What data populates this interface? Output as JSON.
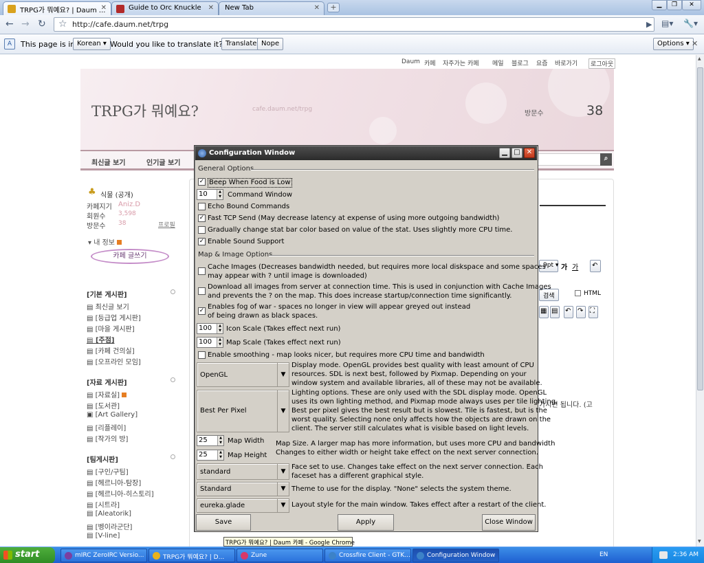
{
  "browser": {
    "tabs": [
      {
        "title": "TRPG가 뭐예요? | Daum ...",
        "active": true
      },
      {
        "title": "Guide to Orc Knuckle",
        "active": false
      },
      {
        "title": "New Tab",
        "active": false
      }
    ],
    "url": "http://cafe.daum.net/trpg",
    "translate_bar": {
      "prefix": "This page is in",
      "language": "Korean",
      "question": "Would you like to translate it?",
      "translate_label": "Translate",
      "nope_label": "Nope",
      "options_label": "Options"
    }
  },
  "page": {
    "gnb": [
      "Daum",
      "카페",
      "자주가는 카페",
      "메일",
      "블로그",
      "요즘",
      "바로가기",
      "로그아웃"
    ],
    "cafe_title": "TRPG가 뭐예요?",
    "cafe_url": "cafe.daum.net/trpg",
    "visitors_label": "방문수",
    "visitors_count": "38",
    "menu": [
      "최신글 보기",
      "인기글 보기"
    ],
    "side": {
      "rank": "식물 (공개)",
      "manager_label": "카페지기",
      "manager_value": "Aniz.D",
      "members_label": "회원수",
      "members_value": "3,598",
      "visit_label": "방문수",
      "visit_value": "38",
      "profile": "프로필",
      "my_info": "내 정보",
      "write_button": "카페 글쓰기",
      "sections": [
        {
          "title": "[기본 게시판]",
          "items": [
            "최신글 보기",
            "[등급업 게시판]",
            "[마을 게시판]",
            "[주점]",
            "[카페 건의실]",
            "[오프라인 모임]"
          ]
        },
        {
          "title": "[자료 게시판]",
          "items": [
            "[자료실]",
            "[도서관]",
            "[Art Gallery]",
            "[리플레이]",
            "[작가의 방]"
          ]
        },
        {
          "title": "[팀게시판]",
          "items": [
            "[구인/구팀]",
            "[헤르니아-탐장]",
            "[헤르니아-히스토리]",
            "[시트라]",
            "[Aleatorik]",
            "[벵이라군단]",
            "[V-line]"
          ]
        }
      ]
    },
    "editor": {
      "font_size": "9pt",
      "html_label": "HTML",
      "search_label": "검색",
      "fragment": "가시면 됩니다. (고"
    }
  },
  "config_window": {
    "title": "Configuration Window",
    "general_label": "General Options",
    "map_label": "Map & Image Options",
    "options": {
      "beep": {
        "label": "Beep When Food is Low",
        "checked": true
      },
      "command_window": {
        "value": "10",
        "label": "Command Window"
      },
      "echo": {
        "label": "Echo Bound Commands",
        "checked": false
      },
      "fast_tcp": {
        "label": "Fast TCP Send (May decrease latency at expense of using more outgoing bandwidth)",
        "checked": true
      },
      "gradual": {
        "label": "Gradually change stat bar color based on value of the stat.  Uses slightly more CPU time.",
        "checked": false
      },
      "sound": {
        "label": "Enable Sound Support",
        "checked": true
      },
      "cache_line1": "Cache Images (Decreases bandwidth needed, but requires more local diskspace and some spaces",
      "cache_line2": "may appear with ? until image is downloaded)",
      "download_line1": "Download all images from server at connection time.  This is used in conjunction with Cache Images",
      "download_line2": "and prevents the ? on the map.  This does increase startup/connection time significantly.",
      "fog_line1": "Enables fog of war - spaces no longer in view will appear greyed out instead",
      "fog_line2": "of being drawn as black spaces.",
      "icon_scale": {
        "value": "100",
        "label": "Icon Scale (Takes effect next run)"
      },
      "map_scale": {
        "value": "100",
        "label": "Map Scale (Takes effect next run)"
      },
      "smoothing": {
        "label": "Enable smoothing - map looks nicer, but requires more CPU time and bandwidth",
        "checked": false
      },
      "display_mode": {
        "value": "OpenGL",
        "desc": [
          "Display mode.  OpenGL provides best quality with least amount of CPU",
          "resources.  SDL is next best, followed by Pixmap.  Depending on your",
          "window system and available libraries, all of these may not be available."
        ]
      },
      "lighting": {
        "value": "Best Per Pixel",
        "desc": [
          "Lighting options.  These are only used with the SDL display mode.  OpenGL",
          "uses its own lighting method, and Pixmap mode always uses per tile lighting.",
          "Best per pixel gives the best result but is slowest.  Tile is fastest, but is the",
          "worst quality.  Selecting none only affects how the objects are drawn on the",
          "client.  The server still calculates what is visible based on light levels."
        ]
      },
      "map_width": {
        "value": "25",
        "label": "Map Width"
      },
      "map_height": {
        "value": "25",
        "label": "Map Height"
      },
      "map_size_desc": [
        "Map Size. A larger map has more information, but uses more CPU and bandwidth",
        "Changes to either width or height take effect on the next server connection."
      ],
      "faceset": {
        "value": "standard",
        "desc": [
          "Face set to use.  Changes take effect on the next server connection.  Each",
          "faceset has a different graphical style."
        ]
      },
      "theme": {
        "value": "Standard",
        "desc": "Theme to use for the display.  \"None\" selects the system theme."
      },
      "layout": {
        "value": "eureka.glade",
        "desc": "Layout style for the main window.  Takes effect after a restart of the client."
      }
    },
    "buttons": {
      "save": "Save",
      "apply": "Apply",
      "close": "Close Window"
    }
  },
  "tooltip": "TRPG가 뭐예요? | Daum 카페 - Google Chrome",
  "taskbar": {
    "start": "start",
    "tasks": [
      {
        "label": "mIRC ZeroIRC Versio...",
        "color": "#7b3fa0"
      },
      {
        "label": "TRPG가 뭐예요? | D...",
        "color": "#e8b21c"
      },
      {
        "label": "Zune",
        "color": "#d9386a"
      },
      {
        "label": "Crossfire Client - GTK...",
        "color": "#3c82c8"
      },
      {
        "label": "Configuration Window",
        "color": "#3c82c8"
      }
    ],
    "lang": "EN",
    "clock": "2:36 AM"
  }
}
